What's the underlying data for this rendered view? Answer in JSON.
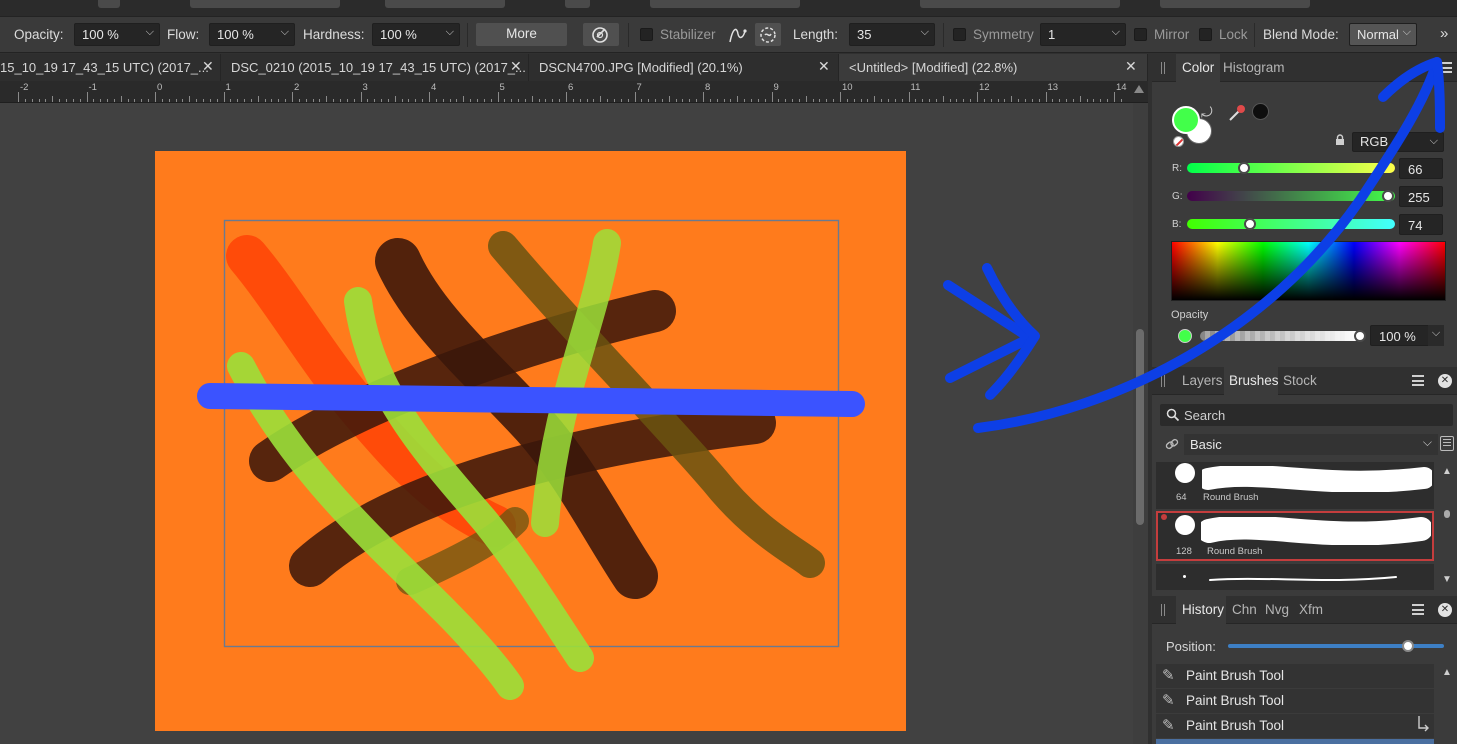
{
  "toolbar": {
    "opacity_label": "Opacity:",
    "opacity_value": "100 %",
    "flow_label": "Flow:",
    "flow_value": "100 %",
    "hardness_label": "Hardness:",
    "hardness_value": "100 %",
    "more_label": "More",
    "stabilizer_label": "Stabilizer",
    "length_label": "Length:",
    "length_value": "35",
    "symmetry_label": "Symmetry",
    "symmetry_value": "1",
    "mirror_label": "Mirror",
    "lock_label": "Lock",
    "blend_mode_label": "Blend Mode:",
    "blend_mode_value": "Normal",
    "overflow_glyph": "»"
  },
  "tabs": [
    {
      "label": "15_10_19 17_43_15 UTC) (2017_..."
    },
    {
      "label": "DSC_0210 (2015_10_19 17_43_15 UTC) (2017_..."
    },
    {
      "label": "DSCN4700.JPG [Modified] (20.1%)"
    },
    {
      "label": "<Untitled> [Modified] (22.8%)"
    }
  ],
  "ruler": {
    "numbers": [
      "-2",
      "-1",
      "0",
      "1",
      "2",
      "3",
      "4",
      "5",
      "6",
      "7",
      "8",
      "9",
      "10",
      "11",
      "12",
      "13",
      "14"
    ]
  },
  "color_panel": {
    "tab_color": "Color",
    "tab_histogram": "Histogram",
    "mode_value": "RGB",
    "r_label": "R:",
    "g_label": "G:",
    "b_label": "B:",
    "r_value": "66",
    "g_value": "255",
    "b_value": "74",
    "opacity_label": "Opacity",
    "opacity_value": "100 %",
    "primary_color": "#42ff4a",
    "secondary_color": "#ffffff"
  },
  "brushes_panel": {
    "tab_layers": "Layers",
    "tab_brushes": "Brushes",
    "tab_stock": "Stock",
    "search_placeholder": "Search",
    "category": "Basic",
    "brushes": [
      {
        "size": "64",
        "name": "Round Brush"
      },
      {
        "size": "128",
        "name": "Round Brush"
      }
    ]
  },
  "history_panel": {
    "tab_history": "History",
    "tab_chn": "Chn",
    "tab_nvg": "Nvg",
    "tab_xfm": "Xfm",
    "position_label": "Position:",
    "items": [
      "Paint Brush Tool",
      "Paint Brush Tool",
      "Paint Brush Tool"
    ]
  },
  "icons": {
    "close": "✕",
    "chevron": "⌄",
    "swap": "⤾",
    "lock": "🔒",
    "brush": "🖌"
  },
  "colors": {
    "artboard": "#ff7b1c",
    "annotation_blue": "#0d3fe6"
  }
}
